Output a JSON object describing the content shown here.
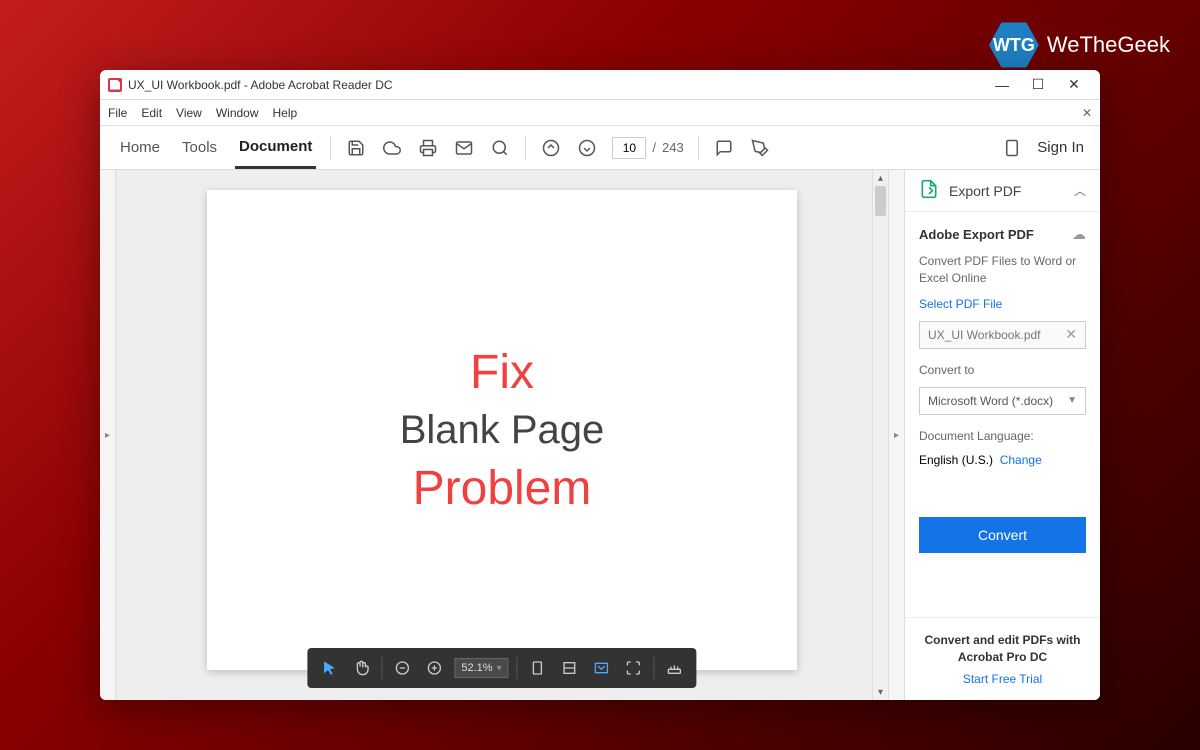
{
  "brand": {
    "name": "WeTheGeek",
    "logo_text": "WTG"
  },
  "titlebar": {
    "title": "UX_UI Workbook.pdf - Adobe Acrobat Reader DC",
    "minimize": "—",
    "maximize": "☐",
    "close": "✕"
  },
  "menubar": {
    "items": [
      "File",
      "Edit",
      "View",
      "Window",
      "Help"
    ],
    "close": "✕"
  },
  "toolbar": {
    "tabs": {
      "home": "Home",
      "tools": "Tools",
      "document": "Document"
    },
    "page_current": "10",
    "page_sep": "/",
    "page_total": "243",
    "signin": "Sign In"
  },
  "document_text": {
    "line1": "Fix",
    "line2": "Blank Page",
    "line3": "Problem"
  },
  "zoom": {
    "value": "52.1%"
  },
  "panel": {
    "header": "Export PDF",
    "title": "Adobe Export PDF",
    "desc": "Convert PDF Files to Word or Excel Online",
    "select_file": "Select PDF File",
    "file_name": "UX_UI Workbook.pdf",
    "convert_to": "Convert to",
    "format": "Microsoft Word (*.docx)",
    "lang_label": "Document Language:",
    "lang_value": "English (U.S.)",
    "change": "Change",
    "convert_btn": "Convert",
    "footer_title": "Convert and edit PDFs with Acrobat Pro DC",
    "footer_link": "Start Free Trial"
  }
}
